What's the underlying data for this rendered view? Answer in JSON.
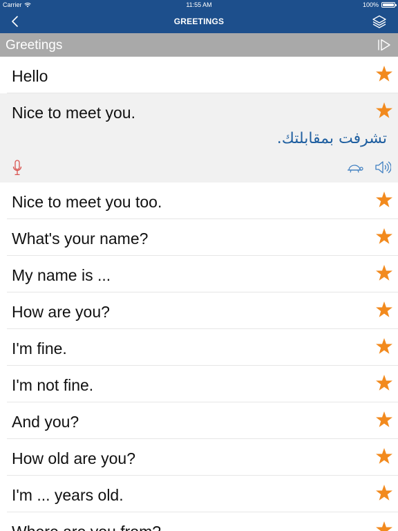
{
  "status_bar": {
    "carrier": "Carrier",
    "time": "11:55 AM",
    "battery": "100%",
    "battery_level": 1.0
  },
  "nav": {
    "title": "GREETINGS",
    "back_icon": "chevron-left-icon",
    "layers_icon": "layers-icon"
  },
  "section": {
    "title": "Greetings",
    "play_icon": "play-all-icon"
  },
  "colors": {
    "nav_bg": "#1d4f8c",
    "section_bg": "#a9a9a9",
    "star": "#f28a1e",
    "translation": "#1f5fa0",
    "mic": "#d9534f",
    "audio_icons": "#3f7fc1",
    "expanded_bg": "#f1f1f1"
  },
  "phrases": [
    {
      "text": "Hello",
      "starred": true
    },
    {
      "text": "Nice to meet you.",
      "starred": true,
      "translation": "تشرفت بمقابلتك.",
      "expanded": true
    },
    {
      "text": "Nice to meet you too.",
      "starred": true
    },
    {
      "text": "What's your name?",
      "starred": true
    },
    {
      "text": "My name is ...",
      "starred": true
    },
    {
      "text": "How are you?",
      "starred": true
    },
    {
      "text": "I'm fine.",
      "starred": true
    },
    {
      "text": "I'm not fine.",
      "starred": true
    },
    {
      "text": "And you?",
      "starred": true
    },
    {
      "text": "How old are you?",
      "starred": true
    },
    {
      "text": "I'm ... years old.",
      "starred": true
    },
    {
      "text": "Where are you from?",
      "starred": true
    }
  ]
}
